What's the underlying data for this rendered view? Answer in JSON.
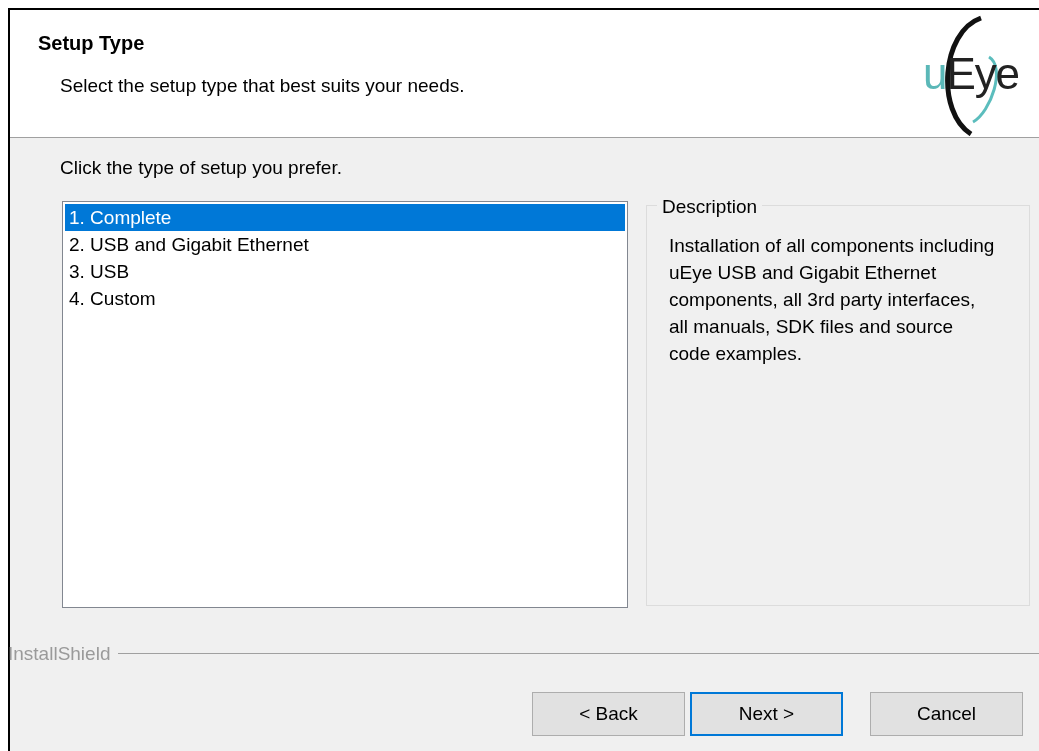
{
  "header": {
    "title": "Setup Type",
    "subtitle": "Select the setup type that best suits your needs.",
    "logo": {
      "prefix": "u",
      "suffix": "Eye"
    }
  },
  "prompt": "Click the type of setup you prefer.",
  "setup_types": [
    {
      "label": "1. Complete",
      "selected": true
    },
    {
      "label": "2. USB and Gigabit Ethernet",
      "selected": false
    },
    {
      "label": "3. USB",
      "selected": false
    },
    {
      "label": "4. Custom",
      "selected": false
    }
  ],
  "description": {
    "legend": "Description",
    "text": "Installation of all components including uEye USB and Gigabit Ethernet components, all 3rd party interfaces, all manuals, SDK files and source code examples."
  },
  "brand": "InstallShield",
  "buttons": [
    {
      "label": "< Back",
      "selected": false
    },
    {
      "label": "Next >",
      "selected": true
    },
    {
      "label": "Cancel",
      "selected": false
    }
  ]
}
